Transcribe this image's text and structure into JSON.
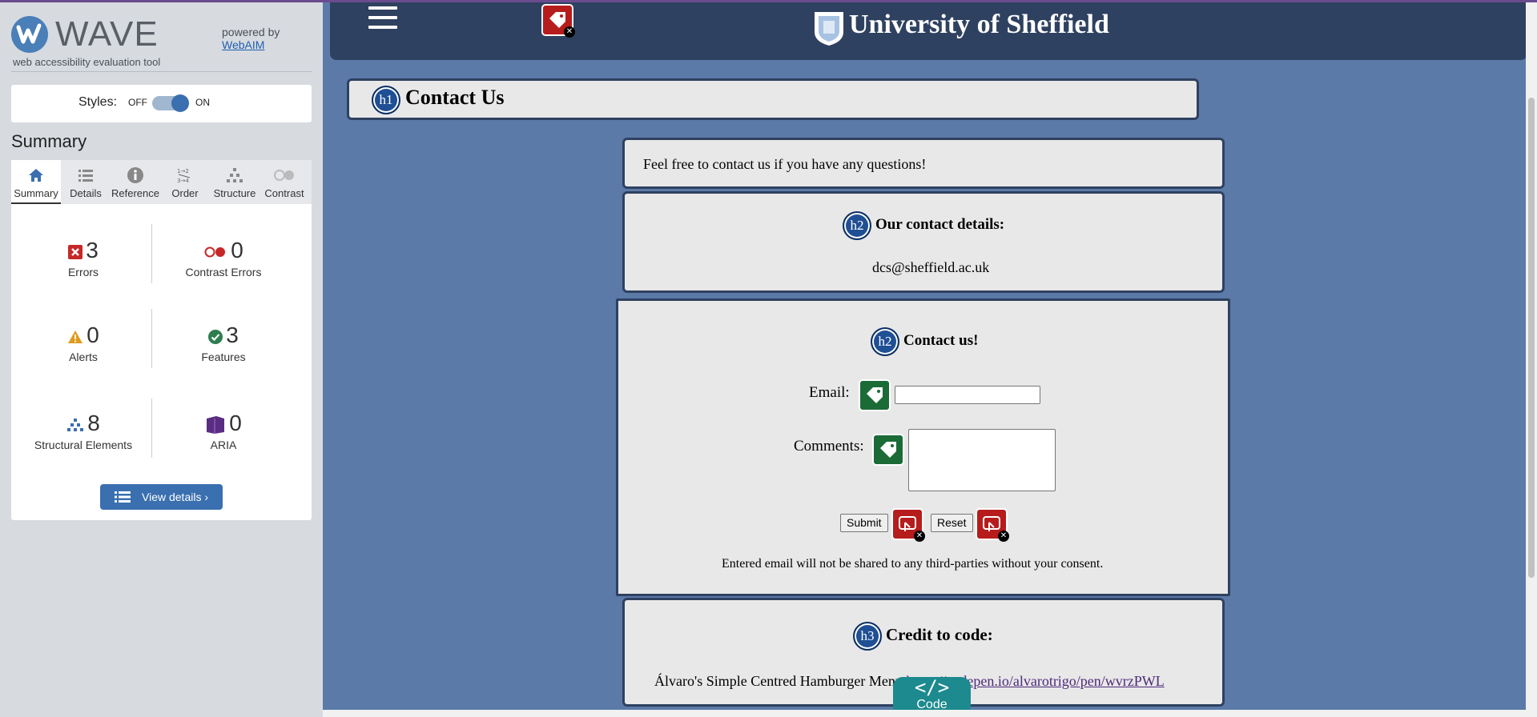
{
  "wave": {
    "logo_text": "WAVE",
    "tagline": "web accessibility evaluation tool",
    "powered_by": "powered by",
    "webaim_link": "WebAIM",
    "styles_label": "Styles:",
    "styles_off": "OFF",
    "styles_on": "ON",
    "styles_state": "on",
    "summary_title": "Summary",
    "tabs": [
      {
        "label": "Summary",
        "icon": "home-icon",
        "active": true
      },
      {
        "label": "Details",
        "icon": "list-icon",
        "active": false
      },
      {
        "label": "Reference",
        "icon": "info-icon",
        "active": false
      },
      {
        "label": "Order",
        "icon": "order-icon",
        "active": false
      },
      {
        "label": "Structure",
        "icon": "structure-icon",
        "active": false
      },
      {
        "label": "Contrast",
        "icon": "contrast-icon",
        "active": false
      }
    ],
    "stats": {
      "errors": {
        "count": "3",
        "label": "Errors",
        "color": "#c62828"
      },
      "contrast_errors": {
        "count": "0",
        "label": "Contrast Errors",
        "color": "#c62828"
      },
      "alerts": {
        "count": "0",
        "label": "Alerts",
        "color": "#e09b1d"
      },
      "features": {
        "count": "3",
        "label": "Features",
        "color": "#2e7d4f"
      },
      "structural": {
        "count": "8",
        "label": "Structural Elements",
        "color": "#3a6fb0"
      },
      "aria": {
        "count": "0",
        "label": "ARIA",
        "color": "#5a2d82"
      }
    },
    "view_details": "View details ›"
  },
  "site": {
    "title": "University of Sheffield",
    "h1": "Contact Us",
    "intro": "Feel free to contact us if you have any questions!",
    "contact_heading": "Our contact details:",
    "contact_email": "dcs@sheffield.ac.uk",
    "form_heading": "Contact us!",
    "email_label": "Email:",
    "email_value": "",
    "comments_label": "Comments:",
    "comments_value": "",
    "submit_label": "Submit",
    "reset_label": "Reset",
    "privacy_note": "Entered email will not be shared to any third-parties without your consent.",
    "credit_heading": "Credit to code:",
    "credit_text": "Álvaro's Simple Centred Hamburger Menu",
    "credit_link": "https://codepen.io/alvarotrigo/pen/wvrzPWL"
  },
  "badges": {
    "h1": "h1",
    "h2": "h2",
    "h3": "h3"
  },
  "code_tab": {
    "glyph": "</>",
    "label": "Code"
  },
  "colors": {
    "page_bg": "#5b7aa8",
    "header_bg": "#2f4160",
    "wave_blue": "#3a6fb0",
    "error_red": "#b71c1c",
    "feature_green": "#1b6b36"
  }
}
